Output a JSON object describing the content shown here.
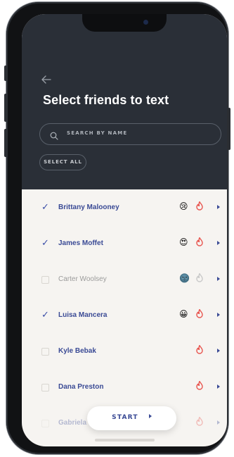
{
  "header": {
    "back_icon": "arrow-left-icon",
    "title": "Select friends to text"
  },
  "search": {
    "icon": "search-icon",
    "placeholder": "SEARCH BY NAME"
  },
  "select_all_label": "SELECT ALL",
  "friends": [
    {
      "name": "Brittany Malooney",
      "checked": true,
      "emoji": "😢",
      "flame_color": "#e8554f"
    },
    {
      "name": "James Moffet",
      "checked": true,
      "emoji": "😍",
      "flame_color": "#e8554f"
    },
    {
      "name": "Carter Woolsey",
      "checked": false,
      "emoji": "🌚",
      "flame_color": "#c9c9c9"
    },
    {
      "name": "Luisa Mancera",
      "checked": true,
      "emoji": "😀",
      "flame_color": "#e8554f"
    },
    {
      "name": "Kyle Bebak",
      "checked": false,
      "emoji": "",
      "flame_color": "#e8554f"
    },
    {
      "name": "Dana Preston",
      "checked": false,
      "emoji": "",
      "flame_color": "#e8554f"
    },
    {
      "name": "Gabriela",
      "checked": false,
      "emoji": "",
      "flame_color": "#e8554f"
    }
  ],
  "start_button_label": "START",
  "colors": {
    "header_bg": "#2a2f37",
    "accent": "#3a4a95",
    "flame": "#e8554f"
  }
}
